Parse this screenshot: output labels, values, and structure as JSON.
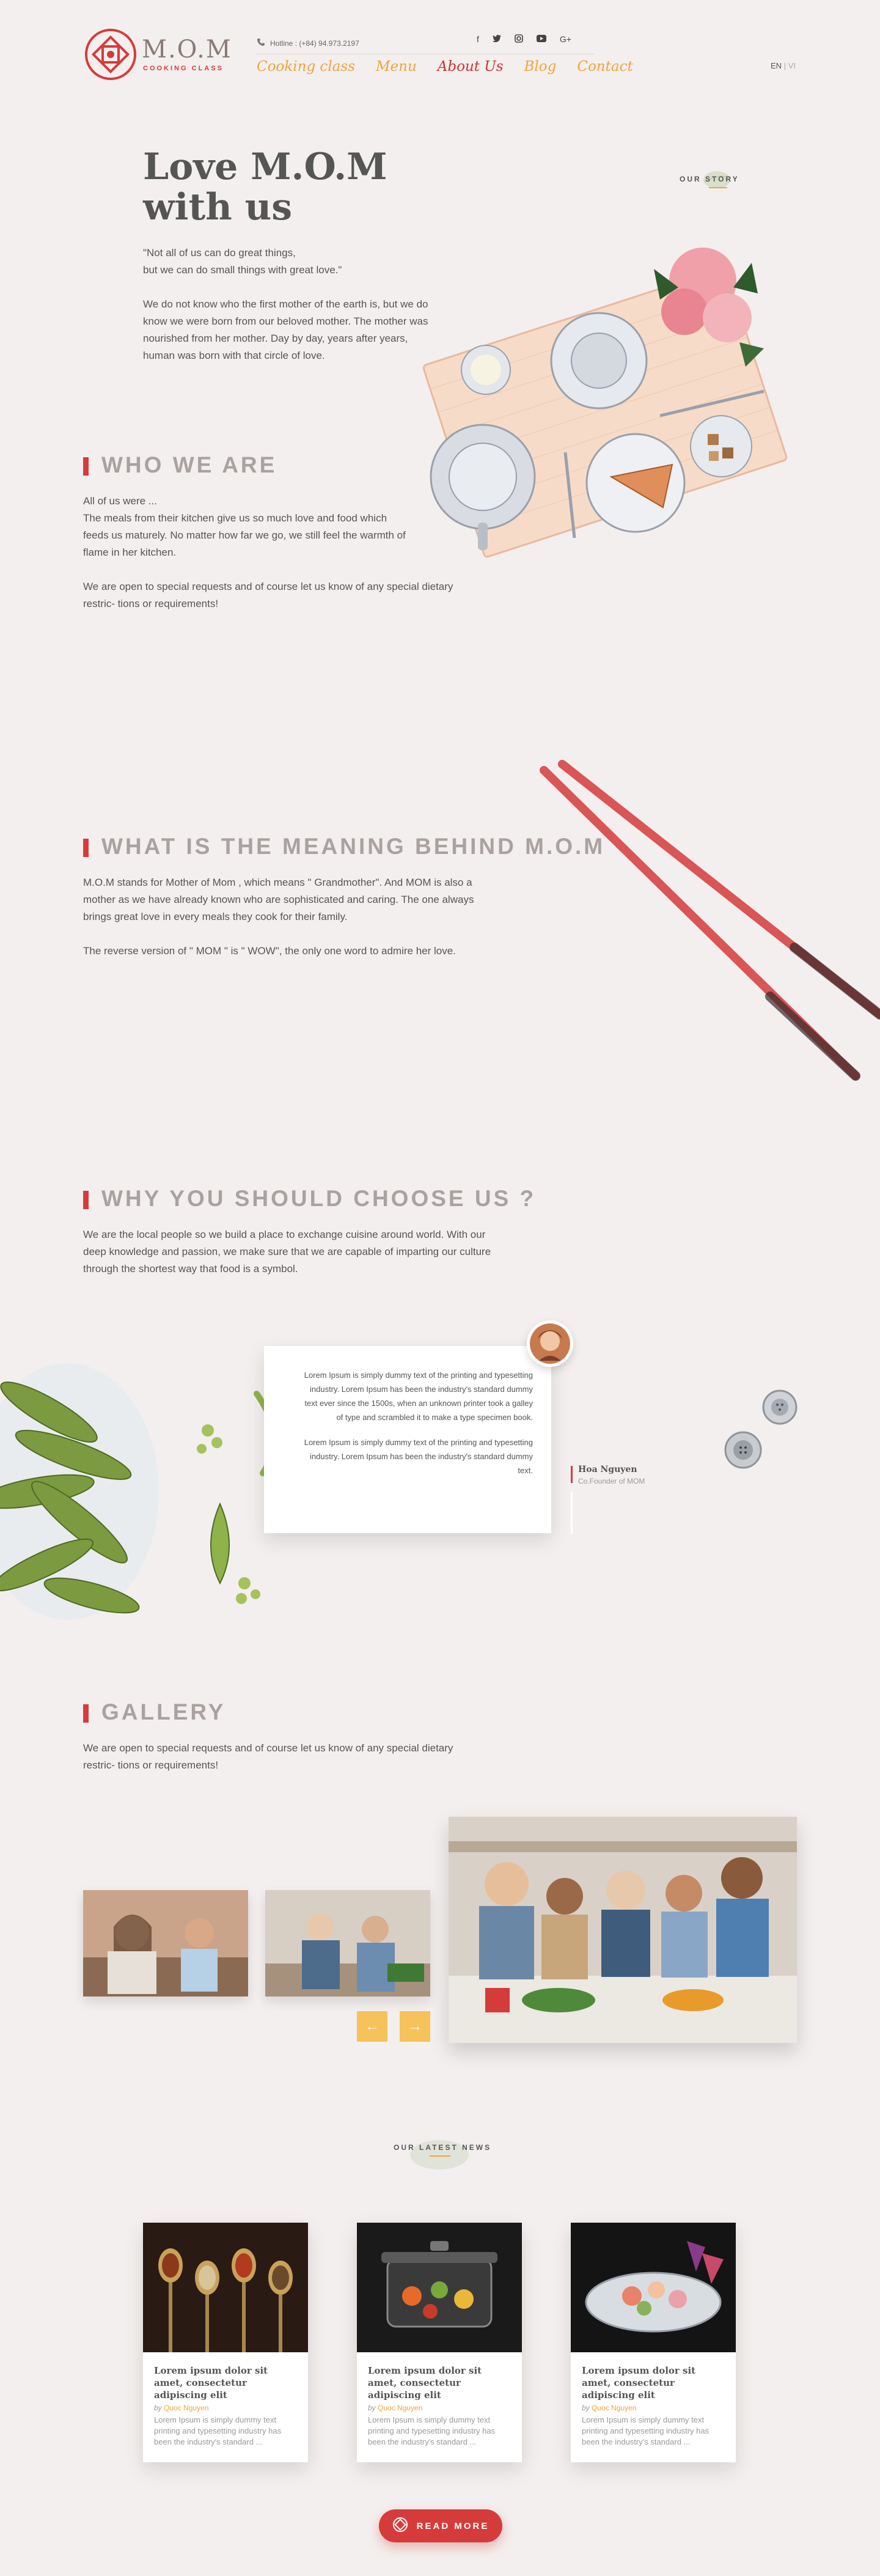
{
  "header": {
    "logo_word": "M.O.M",
    "logo_sub": "COOKING CLASS",
    "hotline": "Hotline : (+84) 94.973.2197",
    "socials": [
      "f",
      "t",
      "ig",
      "yt",
      "G+"
    ],
    "nav": [
      "Cooking class",
      "Menu",
      "About Us",
      "Blog",
      "Contact"
    ],
    "lang_en": "EN",
    "lang_sep": "|",
    "lang_vi": "VI"
  },
  "hero": {
    "title_line1": "Love M.O.M",
    "title_line2": "with us",
    "quote_line1": "\"Not all of us can do great things,",
    "quote_line2": "but we can do small things with great love.\"",
    "body": "We do not know who the first mother of the earth is, but we do know we were born from our beloved mother. The mother was nourished from her mother. Day by day, years after years, human was born with that circle of love.",
    "story_label": "OUR STORY"
  },
  "who": {
    "title": "WHO WE ARE",
    "p1": "All of us were ...",
    "p2": "The meals from their kitchen give us so much love and food which feeds us maturely. No matter how far we go, we still feel the warmth of  flame in her kitchen.",
    "p3": "We are open to special requests and of course let us know of any special dietary restric- tions or requirements!"
  },
  "meaning": {
    "title": "WHAT IS THE MEANING BEHIND M.O.M",
    "p1": "M.O.M stands for Mother of Mom , which means \" Grandmother\". And MOM is also a mother as we have already known who are sophisticated and caring. The one always brings great love in every meals they cook for their family.",
    "p2": "The reverse version of \" MOM \" is \" WOW\", the only one word to admire her love."
  },
  "why": {
    "title": "WHY YOU SHOULD CHOOSE US ?",
    "p1": "We are the local people so we build a place to exchange cuisine around world. With our deep knowledge and passion, we make sure that we are capable of imparting our culture through the shortest way that food is a symbol."
  },
  "testimonial": {
    "p1": "Lorem Ipsum is simply dummy text of the printing and typesetting industry. Lorem Ipsum has been the industry's standard dummy text ever since the 1500s, when an unknown printer took a galley of type and scrambled it to make a type specimen book.",
    "p2": "Lorem Ipsum is simply dummy text of the printing and typesetting industry. Lorem Ipsum has been the industry's standard dummy text.",
    "name": "Hoa Nguyen",
    "role": "Co.Founder of MOM"
  },
  "gallery": {
    "title": "GALLERY",
    "text": "We are open to special requests and of course let us know of any special dietary restric- tions or requirements!",
    "prev": "←",
    "next": "→"
  },
  "news": {
    "label": "OUR LATEST NEWS",
    "items": [
      {
        "title": "Lorem ipsum dolor sit amet, consectetur adipiscing elit",
        "by": "by",
        "author": "Quoc Nguyen",
        "text": "Lorem Ipsum is simply dummy text printing and typesetting industry has been the industry's standard ..."
      },
      {
        "title": "Lorem ipsum dolor sit amet, consectetur adipiscing elit",
        "by": "by",
        "author": "Quoc Nguyen",
        "text": "Lorem Ipsum is simply dummy text printing and typesetting industry has been the industry's standard ..."
      },
      {
        "title": "Lorem ipsum dolor sit amet, consectetur adipiscing elit",
        "by": "by",
        "author": "Quoc Nguyen",
        "text": "Lorem Ipsum is simply dummy text printing and typesetting industry has been the industry's standard ..."
      }
    ],
    "read_more": "READ MORE"
  },
  "colors": {
    "accent_red": "#d63b3b",
    "accent_orange": "#f2a33c",
    "button_yellow": "#f6c25a",
    "background": "#f3efee"
  },
  "icons": [
    "logo-knot-icon",
    "phone-icon",
    "facebook-icon",
    "twitter-icon",
    "instagram-icon",
    "youtube-icon",
    "google-plus-icon",
    "arrow-left-icon",
    "arrow-right-icon"
  ]
}
